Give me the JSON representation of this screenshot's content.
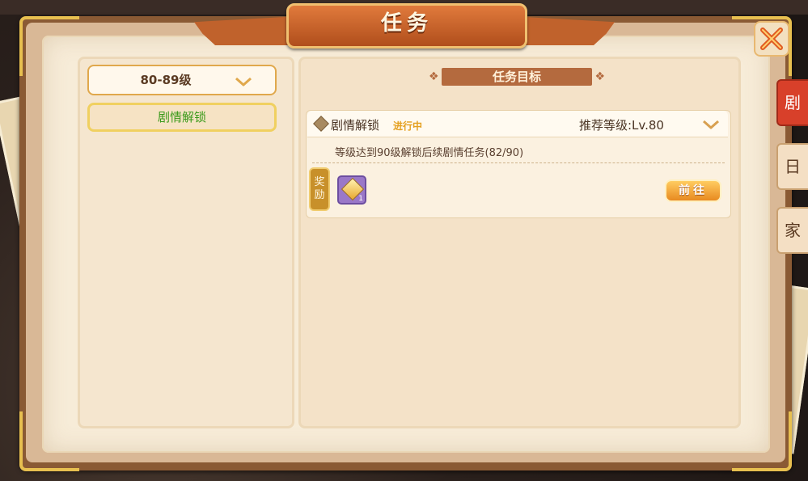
{
  "window": {
    "title": "任务",
    "close_icon": "close-x-icon"
  },
  "left_panel": {
    "level_dropdown": {
      "selected": "80-89级"
    },
    "categories": [
      {
        "label": "剧情解锁",
        "selected": true
      }
    ]
  },
  "right_panel": {
    "section_title": "任务目标",
    "task": {
      "name": "剧情解锁",
      "status": "进行中",
      "recommended_level": "推荐等级:Lv.80",
      "description": "等级达到90级解锁后续剧情任务(82/90)",
      "progress": {
        "current": 82,
        "target": 90
      },
      "reward_label_1": "奖",
      "reward_label_2": "励",
      "reward_items": [
        {
          "icon": "gem-icon",
          "count": "1"
        }
      ],
      "go_button": "前往"
    }
  },
  "side_tabs": [
    {
      "label": "剧",
      "active": true
    },
    {
      "label": "日常",
      "active": false
    },
    {
      "label": "家族",
      "active": false
    }
  ],
  "colors": {
    "accent_orange": "#c0622c",
    "status_yellow": "#e4a020",
    "category_green": "#3a9a1a",
    "page_bg": "#f7ecd8"
  }
}
